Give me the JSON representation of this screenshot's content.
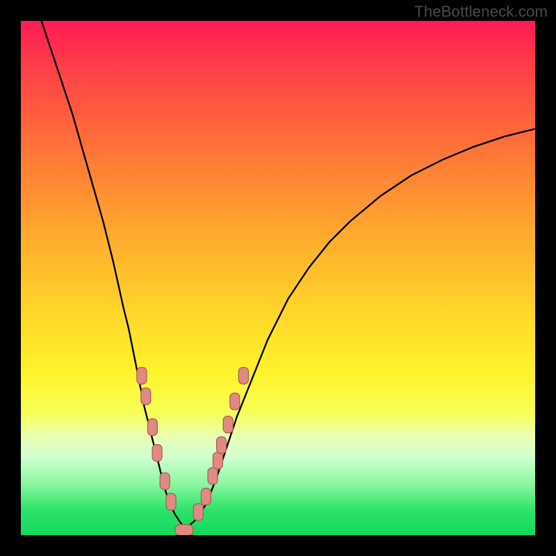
{
  "watermark": "TheBottleneck.com",
  "colors": {
    "background": "#000000",
    "curve": "#000000",
    "marker_fill": "#e08a83",
    "marker_stroke": "#a65a52",
    "gradient": [
      "#ff1a55",
      "#ffa52e",
      "#fff22a",
      "#11d95c"
    ]
  },
  "chart_data": {
    "type": "line",
    "title": "",
    "xlabel": "",
    "ylabel": "",
    "xlim": [
      0,
      100
    ],
    "ylim": [
      0,
      100
    ],
    "series": [
      {
        "name": "left-branch",
        "x": [
          4,
          6,
          8,
          10,
          12,
          14,
          16,
          18,
          20,
          21,
          22,
          23,
          24,
          25,
          26,
          26.5,
          27,
          27.5,
          28,
          29,
          30,
          31,
          32
        ],
        "values": [
          100,
          94,
          88,
          82,
          75,
          68,
          61,
          53,
          44,
          40,
          35,
          30,
          25,
          21,
          17,
          15,
          13,
          11,
          9,
          6,
          4,
          2.5,
          1.2
        ]
      },
      {
        "name": "right-branch",
        "x": [
          32,
          34,
          36,
          38,
          40,
          42,
          44,
          46,
          48,
          52,
          56,
          60,
          64,
          70,
          76,
          82,
          88,
          94,
          100
        ],
        "values": [
          1.2,
          3,
          6,
          11,
          17,
          23,
          28,
          33,
          38,
          46,
          52,
          57,
          61,
          66,
          70,
          73,
          75.5,
          77.5,
          79
        ]
      }
    ],
    "markers": {
      "left": [
        [
          23.5,
          31
        ],
        [
          24.3,
          27
        ],
        [
          25.6,
          21
        ],
        [
          26.5,
          16
        ],
        [
          28.0,
          10.5
        ],
        [
          29.2,
          6.5
        ]
      ],
      "right": [
        [
          34.5,
          4.5
        ],
        [
          36.0,
          7.5
        ],
        [
          37.3,
          11.5
        ],
        [
          38.3,
          14.5
        ],
        [
          39.0,
          17.5
        ],
        [
          40.3,
          21.5
        ],
        [
          41.6,
          26.0
        ],
        [
          43.3,
          31.0
        ]
      ],
      "bottom_bar": {
        "x0": 30.0,
        "x1": 33.5,
        "y": 1.0
      }
    }
  }
}
